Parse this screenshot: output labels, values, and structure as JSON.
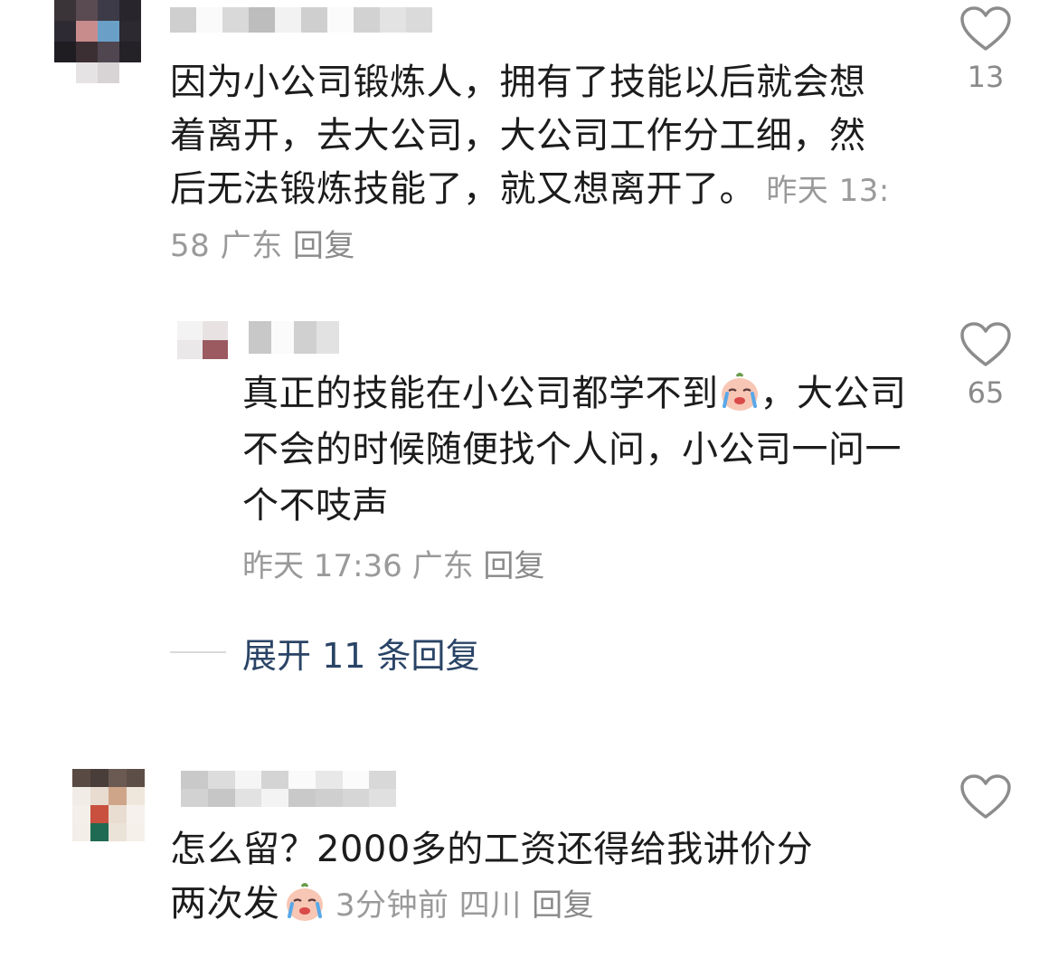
{
  "comments": [
    {
      "text": "因为小公司锻炼人，拥有了技能以后就会想着离开，去大公司，大公司工作分工细，然后无法锻炼技能了，就又想离开了。",
      "time": "昨天 13:58",
      "location": "广东",
      "reply_label": "回复",
      "like_count": "13"
    },
    {
      "text_before_emoji": "真正的技能在小公司都学不到",
      "text_after_emoji": "，大公司不会的时候随便找个人问，小公司一问一个不吱声",
      "time": "昨天 17:36",
      "location": "广东",
      "reply_label": "回复",
      "like_count": "65"
    },
    {
      "text_line1": "怎么留？2000多的工资还得给我讲价分",
      "text_line2": "两次发",
      "time": "3分钟前",
      "location": "四川",
      "reply_label": "回复"
    }
  ],
  "expand_replies": "展开 11 条回复",
  "icons": {
    "like": "heart-outline-icon",
    "emoji": "crying-face-emoji-icon"
  },
  "colors": {
    "text": "#1c1c1c",
    "meta": "#9a9a9a",
    "link": "#2a4466",
    "icon": "#8c8c8c"
  }
}
